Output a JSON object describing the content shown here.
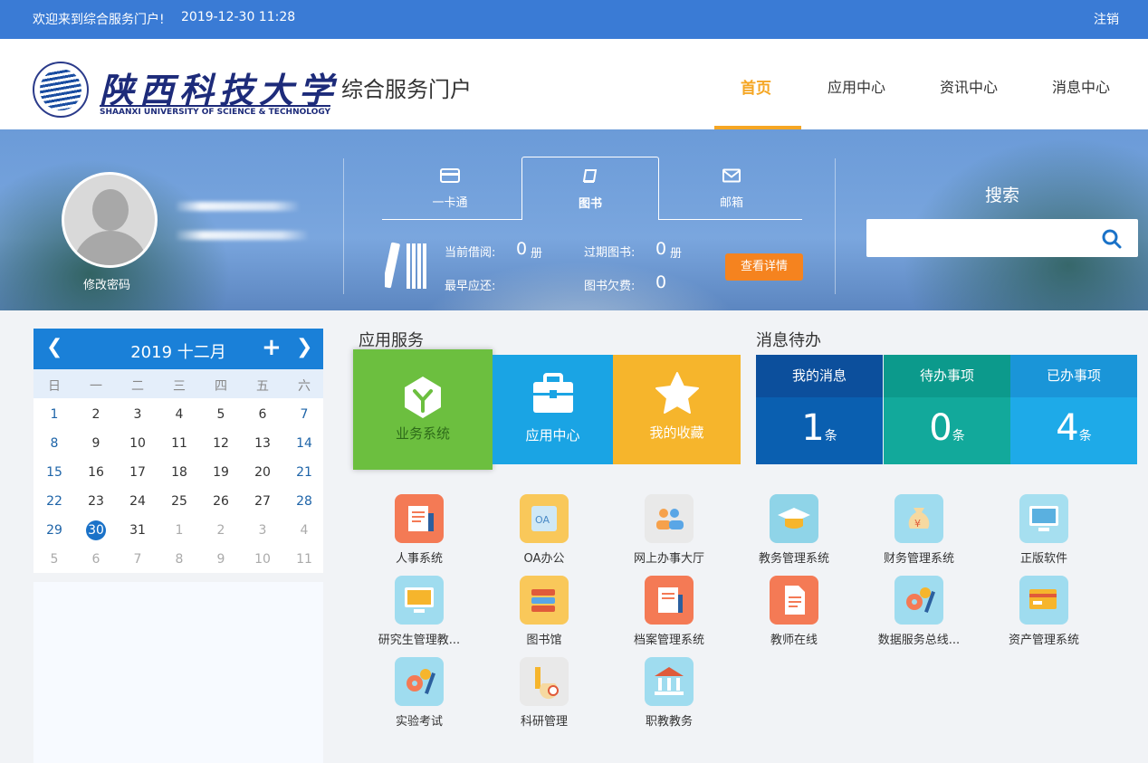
{
  "topbar": {
    "welcome": "欢迎来到综合服务门户!",
    "datetime": "2019-12-30 11:28",
    "logout": "注销"
  },
  "header": {
    "logo_cn": "陕西科技大学",
    "logo_en": "SHAANXI UNIVERSITY OF SCIENCE & TECHNOLOGY",
    "portal_title": "综合服务门户",
    "nav": [
      "首页",
      "应用中心",
      "资讯中心",
      "消息中心"
    ]
  },
  "profile": {
    "change_password": "修改密码"
  },
  "library": {
    "tabs": [
      "一卡通",
      "图书",
      "邮箱"
    ],
    "current_borrow_label": "当前借阅:",
    "current_borrow_value": "0",
    "current_borrow_unit": "册",
    "overdue_label": "过期图书:",
    "overdue_value": "0",
    "overdue_unit": "册",
    "earliest_return_label": "最早应还:",
    "fine_label": "图书欠费:",
    "fine_value": "0",
    "detail_button": "查看详情"
  },
  "search": {
    "label": "搜索",
    "placeholder": "",
    "icon": "search-icon"
  },
  "calendar": {
    "title": "2019 十二月",
    "weekdays": [
      "日",
      "一",
      "二",
      "三",
      "四",
      "五",
      "六"
    ],
    "weeks": [
      [
        "1",
        "2",
        "3",
        "4",
        "5",
        "6",
        "7"
      ],
      [
        "8",
        "9",
        "10",
        "11",
        "12",
        "13",
        "14"
      ],
      [
        "15",
        "16",
        "17",
        "18",
        "19",
        "20",
        "21"
      ],
      [
        "22",
        "23",
        "24",
        "25",
        "26",
        "27",
        "28"
      ],
      [
        "29",
        "30",
        "31",
        "1",
        "2",
        "3",
        "4"
      ],
      [
        "5",
        "6",
        "7",
        "8",
        "9",
        "10",
        "11"
      ]
    ],
    "today": "30"
  },
  "services": {
    "title": "应用服务",
    "tiles": [
      {
        "label": "业务系统",
        "color": "#6cbf3f"
      },
      {
        "label": "应用中心",
        "color": "#1aa4e4"
      },
      {
        "label": "我的收藏",
        "color": "#f6b52c"
      }
    ]
  },
  "messages": {
    "title": "消息待办",
    "items": [
      {
        "label": "我的消息",
        "count": "1",
        "unit": "条",
        "head_color": "#0c4f9c",
        "color": "#0a5fb0"
      },
      {
        "label": "待办事项",
        "count": "0",
        "unit": "条",
        "head_color": "#0c9a8c",
        "color": "#12a99b"
      },
      {
        "label": "已办事项",
        "count": "4",
        "unit": "条",
        "head_color": "#1a95d8",
        "color": "#1eaae8"
      }
    ]
  },
  "apps": [
    {
      "label": "人事系统",
      "icon": "personnel-icon",
      "color": "#f47a55"
    },
    {
      "label": "OA办公",
      "icon": "oa-icon",
      "color": "#f9c85a"
    },
    {
      "label": "网上办事大厅",
      "icon": "service-hall-icon",
      "color": "#e9e9e9"
    },
    {
      "label": "教务管理系统",
      "icon": "graduation-cap-icon",
      "color": "#8fd4e8"
    },
    {
      "label": "财务管理系统",
      "icon": "money-bag-icon",
      "color": "#9fdcef"
    },
    {
      "label": "正版软件",
      "icon": "software-icon",
      "color": "#a6dff0"
    },
    {
      "label": "研究生管理教...",
      "icon": "monitor-icon",
      "color": "#9fdcef"
    },
    {
      "label": "图书馆",
      "icon": "library-icon",
      "color": "#f9c85a"
    },
    {
      "label": "档案管理系统",
      "icon": "archive-icon",
      "color": "#f47a55"
    },
    {
      "label": "教师在线",
      "icon": "document-icon",
      "color": "#f47a55"
    },
    {
      "label": "数据服务总线...",
      "icon": "gears-icon",
      "color": "#9fdcef"
    },
    {
      "label": "资产管理系统",
      "icon": "assets-icon",
      "color": "#9fdcef"
    },
    {
      "label": "实验考试",
      "icon": "lab-gears-icon",
      "color": "#9fdcef"
    },
    {
      "label": "科研管理",
      "icon": "research-icon",
      "color": "#e9e9e9"
    },
    {
      "label": "职教教务",
      "icon": "bank-icon",
      "color": "#9fdcef"
    }
  ]
}
